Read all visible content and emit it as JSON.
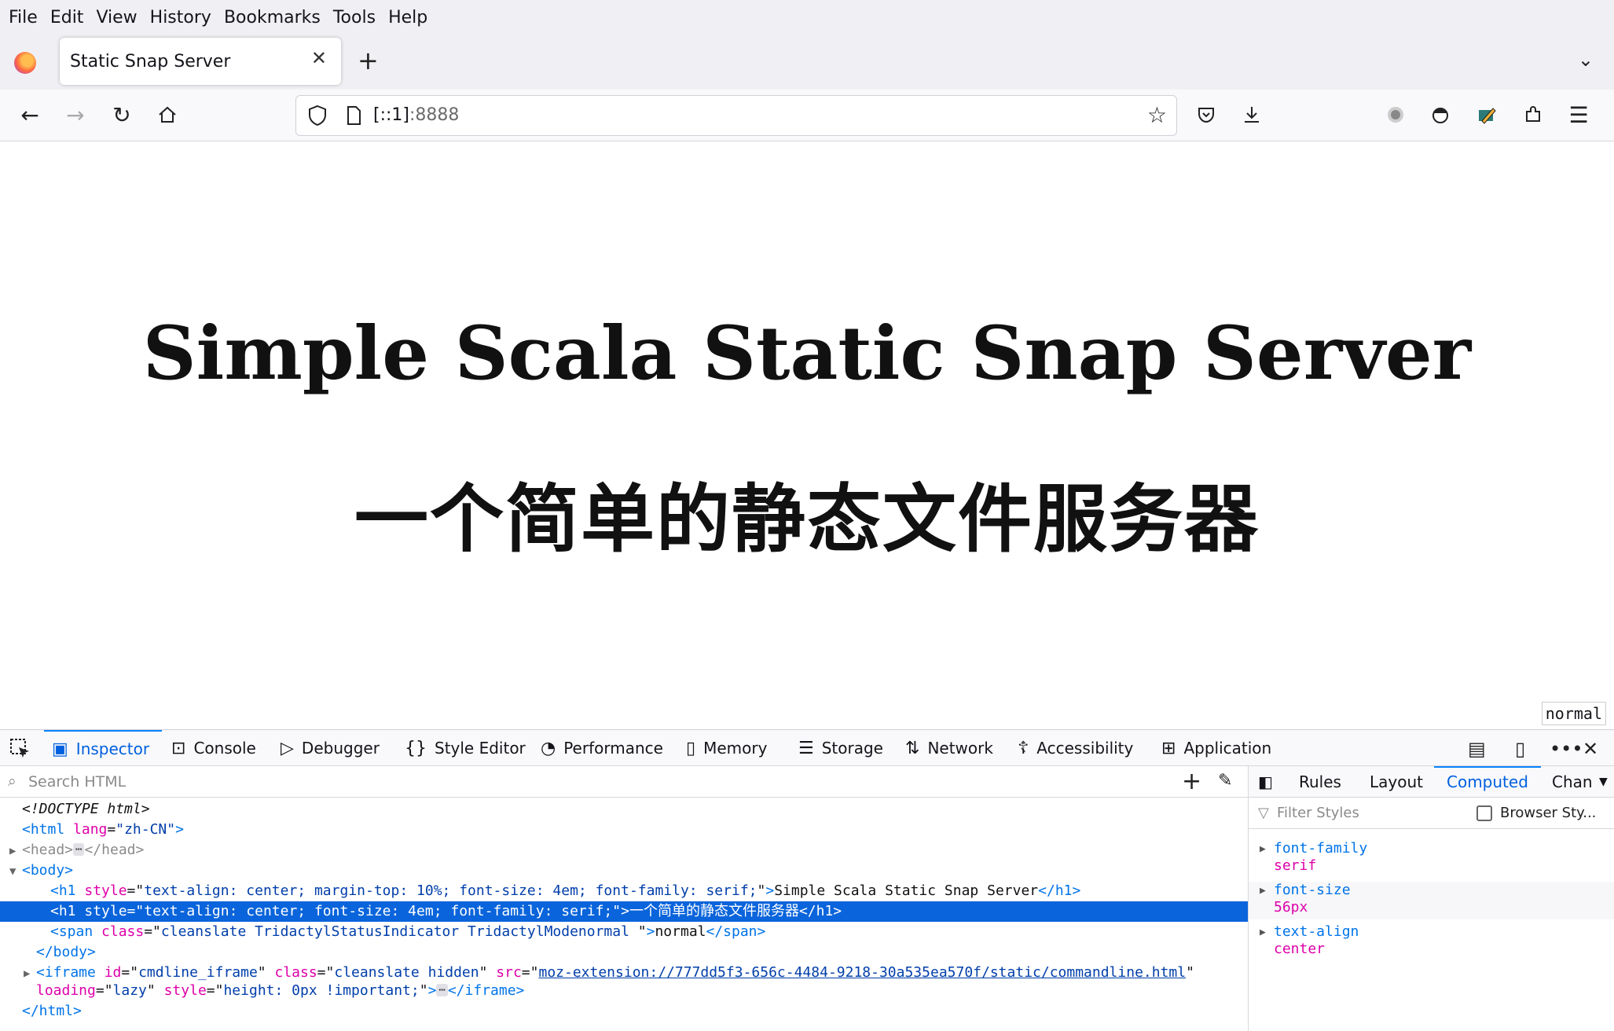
{
  "menu": [
    "File",
    "Edit",
    "View",
    "History",
    "Bookmarks",
    "Tools",
    "Help"
  ],
  "tab": {
    "title": "Static Snap Server"
  },
  "url": {
    "host": "[::1]",
    "port": ":8888"
  },
  "page": {
    "h1_en": "Simple Scala Static Snap Server",
    "h1_zh": "一个简单的静态文件服务器",
    "mode": "normal"
  },
  "devtools": {
    "tabs": [
      "Inspector",
      "Console",
      "Debugger",
      "Style Editor",
      "Performance",
      "Memory",
      "Storage",
      "Network",
      "Accessibility",
      "Application"
    ],
    "search_placeholder": "Search HTML",
    "sidebar_tabs": [
      "Rules",
      "Layout",
      "Computed",
      "Chan"
    ],
    "filter_placeholder": "Filter Styles",
    "browser_styles": "Browser Sty...",
    "computed": [
      {
        "name": "font-family",
        "value": "serif"
      },
      {
        "name": "font-size",
        "value": "56px"
      },
      {
        "name": "text-align",
        "value": "center"
      }
    ],
    "markup": {
      "doctype": "<!DOCTYPE html>",
      "h1a_style": "text-align: center; margin-top: 10%; font-size: 4em; font-family: serif;",
      "h1a_text": "Simple Scala Static Snap Server",
      "h1b_style": "text-align: center; font-size: 4em; font-family: serif;",
      "h1b_text": "一个简单的静态文件服务器",
      "span_class": "cleanslate TridactylStatusIndicator TridactylModenormal ",
      "span_text": "normal",
      "iframe_id": "cmdline_iframe",
      "iframe_class": "cleanslate hidden",
      "iframe_src": "moz-extension://777dd5f3-656c-4484-9218-30a535ea570f/static/commandline.html",
      "iframe_loading": "lazy",
      "iframe_style": "height: 0px !important;"
    }
  }
}
